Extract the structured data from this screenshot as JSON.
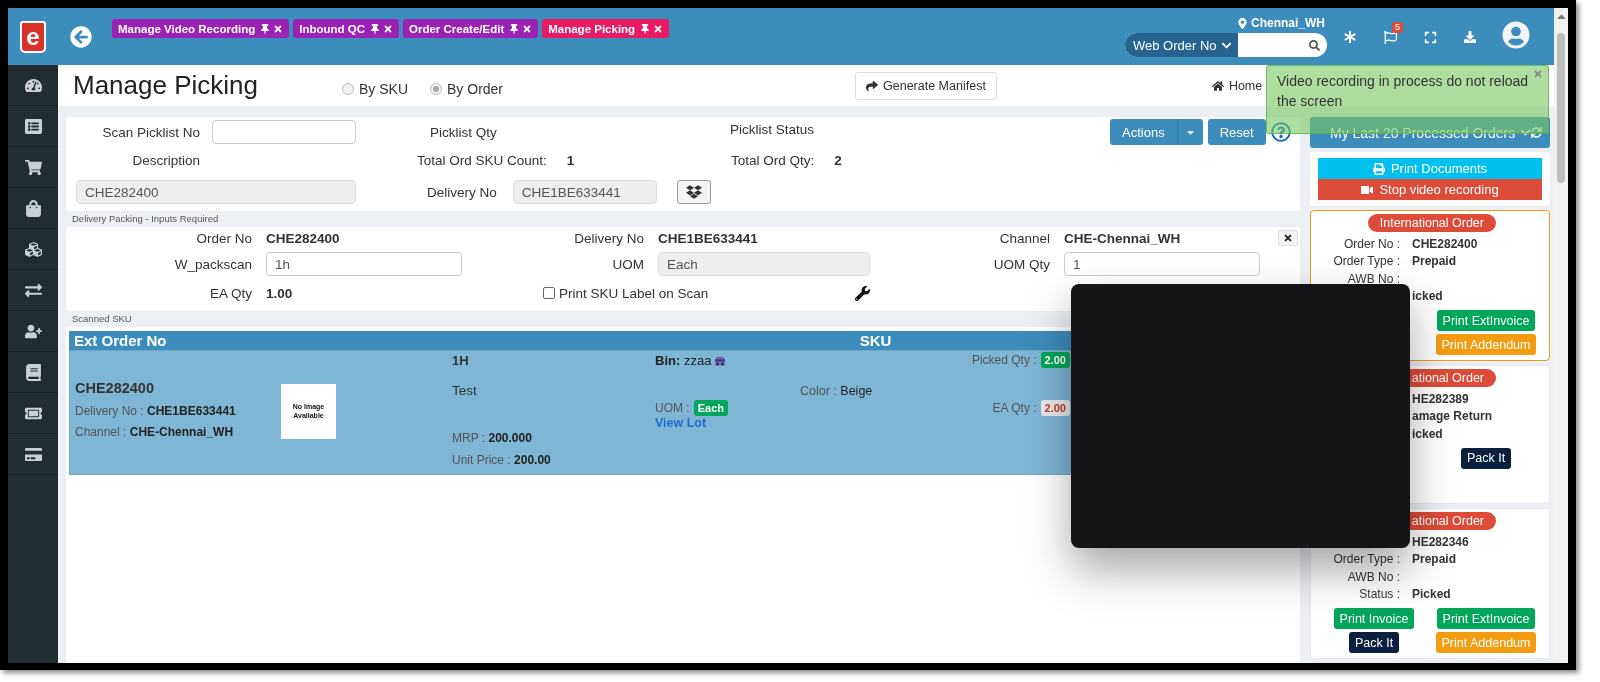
{
  "logo": {
    "text": "e"
  },
  "tabs": [
    {
      "label": "Manage Video Recording",
      "selected": false
    },
    {
      "label": "Inbound QC",
      "selected": false
    },
    {
      "label": "Order Create/Edit",
      "selected": false
    },
    {
      "label": "Manage Picking",
      "selected": true
    }
  ],
  "location": "Chennai_WH",
  "search": {
    "scope": "Web Order No"
  },
  "notifications": {
    "count": "5"
  },
  "page": {
    "title": "Manage Picking",
    "modes": [
      {
        "label": "By SKU",
        "selected": false
      },
      {
        "label": "By Order",
        "selected": true
      }
    ],
    "manifest_button": "Generate Manifest",
    "breadcrumb": [
      "Home"
    ]
  },
  "picklist": {
    "scan_label": "Scan Picklist No",
    "qty_label": "Picklist Qty",
    "status_label": "Picklist Status",
    "description_label": "Description",
    "sku_count_label": "Total Ord SKU Count:",
    "sku_count": "1",
    "qty_total_label": "Total Ord Qty:",
    "qty_total": "2",
    "description_value": "CHE282400",
    "delivery_label": "Delivery No",
    "delivery_value": "CHE1BE633441",
    "actions_button": "Actions",
    "reset_button": "Reset"
  },
  "packing": {
    "legend": "Delivery Packing - Inputs Required",
    "fields": [
      {
        "label": "Order No",
        "value": "CHE282400",
        "kind": "text"
      },
      {
        "label": "Delivery No",
        "value": "CHE1BE633441",
        "kind": "text"
      },
      {
        "label": "Channel",
        "value": "CHE-Chennai_WH",
        "kind": "text"
      },
      {
        "label": "W_packscan",
        "value": "1h",
        "kind": "input"
      },
      {
        "label": "UOM",
        "value": "Each",
        "kind": "readonly"
      },
      {
        "label": "UOM Qty",
        "value": "1",
        "kind": "input"
      },
      {
        "label": "EA Qty",
        "value": "1.00",
        "kind": "text"
      }
    ],
    "checkbox": {
      "label": "Print SKU Label on Scan",
      "checked": false
    }
  },
  "scanned": {
    "legend": "Scanned SKU",
    "columns": [
      "Ext Order No",
      "SKU"
    ],
    "rows": [
      {
        "order_no": "CHE282400",
        "delivery_label": "Delivery No :",
        "delivery_no": "CHE1BE633441",
        "channel_label": "Channel :",
        "channel": "CHE-Chennai_WH",
        "image_text": "No Image Available",
        "sku": "1H",
        "description": "Test",
        "mrp_label": "MRP :",
        "mrp": "200.000",
        "unit_price_label": "Unit Price :",
        "unit_price": "200.00",
        "bin_label": "Bin:",
        "bin": "zzaa",
        "uom_label": "UOM :",
        "uom": "Each",
        "lot_link": "View Lot",
        "color_label": "Color :",
        "color_value": "Beige",
        "picked_label": "Picked Qty :",
        "picked_qty": "2.00",
        "ea_label": "EA Qty :",
        "ea_qty": "2.00"
      }
    ]
  },
  "sidebar": {
    "title": "My Last 20 Processed Orders",
    "actions": [
      {
        "label": "Print Documents",
        "kind": "print"
      },
      {
        "label": "Stop video recording",
        "kind": "stop"
      }
    ],
    "orders": [
      {
        "badge": "International Order",
        "selected": true,
        "rows": [
          {
            "label": "Order No :",
            "value": "CHE282400"
          },
          {
            "label": "Order Type :",
            "value": "Prepaid"
          },
          {
            "label": "AWB No :"
          },
          {
            "value": "icked"
          }
        ],
        "right_buttons": [
          {
            "label": "Print ExtInvoice",
            "kind": "invoice"
          },
          {
            "label": "Print Addendum",
            "kind": "addendum"
          }
        ]
      },
      {
        "badge": "ational Order",
        "selected": false,
        "rows": [
          {
            "value": "HE282389"
          },
          {
            "value": "amage Return"
          },
          {
            "value": "icked"
          }
        ],
        "right_buttons": [
          {
            "label": "Pack It",
            "kind": "pack"
          }
        ]
      },
      {
        "badge": "ational Order",
        "selected": false,
        "rows": [
          {
            "value": "HE282346"
          },
          {
            "label": "Order Type :",
            "value": "Prepaid"
          },
          {
            "label": "AWB No :"
          },
          {
            "label": "Status :",
            "value": "Picked"
          }
        ],
        "left_buttons": [
          {
            "label": "Print Invoice",
            "kind": "invoice"
          },
          {
            "label": "Pack It",
            "kind": "pack"
          }
        ],
        "right_buttons": [
          {
            "label": "Print ExtInvoice",
            "kind": "invoice"
          },
          {
            "label": "Print Addendum",
            "kind": "addendum"
          }
        ]
      }
    ]
  },
  "toast": {
    "message": "Video recording in process do not reload the screen"
  }
}
